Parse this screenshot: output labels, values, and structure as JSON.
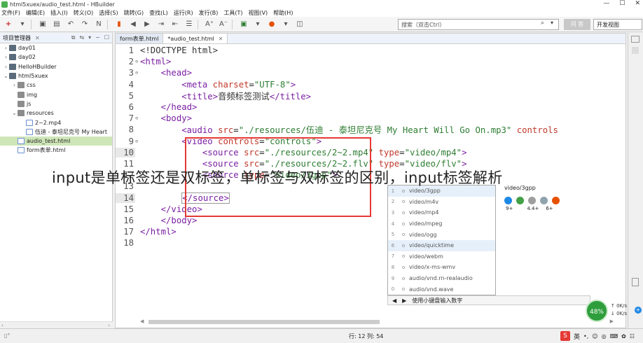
{
  "window": {
    "title": "html5xuex/audio_test.html  -  HBuilder"
  },
  "menu": [
    "文件(F)",
    "编辑(E)",
    "插入(I)",
    "转义(O)",
    "选择(S)",
    "跳转(G)",
    "查找(L)",
    "运行(R)",
    "发行(B)",
    "工具(T)",
    "视图(V)",
    "帮助(H)"
  ],
  "toolbar": {
    "search_placeholder": "搜索（双击Ctrl）",
    "ask_label": "问 答",
    "view_select": "开发视图"
  },
  "project_panel": {
    "title": "项目管理器",
    "items": [
      {
        "label": "day01",
        "depth": 0,
        "arrow": ">",
        "icon": "project"
      },
      {
        "label": "day02",
        "depth": 0,
        "arrow": ">",
        "icon": "project"
      },
      {
        "label": "HelloHBuilder",
        "depth": 0,
        "arrow": ">",
        "icon": "project"
      },
      {
        "label": "html5xuex",
        "depth": 0,
        "arrow": "v",
        "icon": "project"
      },
      {
        "label": "css",
        "depth": 1,
        "arrow": ">",
        "icon": "folder"
      },
      {
        "label": "img",
        "depth": 1,
        "arrow": "",
        "icon": "folder"
      },
      {
        "label": "js",
        "depth": 1,
        "arrow": "",
        "icon": "folder"
      },
      {
        "label": "resources",
        "depth": 1,
        "arrow": "v",
        "icon": "folder"
      },
      {
        "label": "2~2.mp4",
        "depth": 2,
        "arrow": "",
        "icon": "file"
      },
      {
        "label": "伍迪 - 泰坦尼克号 My Heart",
        "depth": 2,
        "arrow": "",
        "icon": "file"
      },
      {
        "label": "audio_test.html",
        "depth": 1,
        "arrow": "",
        "icon": "file",
        "selected": true
      },
      {
        "label": "form表单.html",
        "depth": 1,
        "arrow": "",
        "icon": "file"
      }
    ]
  },
  "tabs": [
    {
      "label": "form表单.html",
      "active": false
    },
    {
      "label": "*audio_test.html",
      "active": true
    }
  ],
  "code_lines": [
    {
      "n": "1",
      "fold": "",
      "html": "<span class='t-txt'>&lt;!DOCTYPE html&gt;</span>"
    },
    {
      "n": "2",
      "fold": "⊖",
      "html": "<span class='t-tag'>&lt;html&gt;</span>"
    },
    {
      "n": "3",
      "fold": "⊖",
      "html": "    <span class='t-tag'>&lt;head&gt;</span>"
    },
    {
      "n": "4",
      "fold": "",
      "html": "        <span class='t-tag'>&lt;meta</span> <span class='t-attr'>charset</span>=<span class='t-val'>\"UTF-8\"</span><span class='t-tag'>&gt;</span>"
    },
    {
      "n": "5",
      "fold": "",
      "html": "        <span class='t-tag'>&lt;title&gt;</span><span class='t-txt'>音频标签测试</span><span class='t-tag'>&lt;/title&gt;</span>"
    },
    {
      "n": "6",
      "fold": "",
      "html": "    <span class='t-tag'>&lt;/head&gt;</span>"
    },
    {
      "n": "7",
      "fold": "⊖",
      "html": "    <span class='t-tag'>&lt;body&gt;</span>"
    },
    {
      "n": "8",
      "fold": "",
      "html": "        <span class='t-tag'>&lt;audio</span> <span class='t-attr'>src</span>=<span class='t-val'>\"./resources/伍迪 - 泰坦尼克号 My Heart Will Go On.mp3\"</span> <span class='t-attr'>controls</span>"
    },
    {
      "n": "9",
      "fold": "⊖",
      "html": "        <span class='t-tag'>&lt;video</span> <span class='t-attr'>controls</span>=<span class='t-val'>\"controls\"</span><span class='t-tag'>&gt;</span>"
    },
    {
      "n": "10",
      "fold": "",
      "html": "            <span class='t-tag'>&lt;source</span> <span class='t-attr'>src</span>=<span class='t-val'>\"./resources/2~2.mp4\"</span> <span class='t-attr'>type</span>=<span class='t-val'>\"video/mp4\"</span><span class='t-tag'>&gt;</span>",
      "hl": true
    },
    {
      "n": "11",
      "fold": "",
      "html": "            <span class='t-tag'>&lt;source</span> <span class='t-attr'>src</span>=<span class='t-val'>\"./resources/2~2.flv\"</span> <span class='t-attr'>type</span>=<span class='t-val'>\"video/flv\"</span><span class='t-tag'>&gt;</span>"
    },
    {
      "n": "12",
      "fold": "",
      "html": "            <span class='t-tag'>&lt;source</span> <span class='t-attr'>type</span>=<span class='t-val'>\"video/3gpp\"</span><span class='t-tag'>&gt;</span>"
    },
    {
      "n": "13",
      "fold": "",
      "html": ""
    },
    {
      "n": "14",
      "fold": "",
      "html": "        <span class='t-tag' style='border:1px solid #999'>&lt;/source&gt;</span>",
      "hl": true
    },
    {
      "n": "15",
      "fold": "",
      "html": "    <span class='t-tag'>&lt;/video&gt;</span>"
    },
    {
      "n": "16",
      "fold": "",
      "html": "    <span class='t-tag'>&lt;/body&gt;</span>"
    },
    {
      "n": "17",
      "fold": "",
      "html": "<span class='t-tag'>&lt;/html&gt;</span>"
    },
    {
      "n": "18",
      "fold": "",
      "html": ""
    }
  ],
  "autocomplete": {
    "items": [
      {
        "n": "1",
        "label": "video/3gpp",
        "sel": true
      },
      {
        "n": "2",
        "label": "video/m4v"
      },
      {
        "n": "3",
        "label": "video/mp4"
      },
      {
        "n": "4",
        "label": "video/mpeg"
      },
      {
        "n": "5",
        "label": "video/ogg"
      },
      {
        "n": "6",
        "label": "video/quicktime",
        "sel": true
      },
      {
        "n": "7",
        "label": "video/webm"
      },
      {
        "n": "8",
        "label": "video/x-ms-wmv"
      },
      {
        "n": "9",
        "label": "audio/vnd.rn-realaudio"
      },
      {
        "n": "0",
        "label": "audio/vnd.wave"
      }
    ],
    "detail_title": "video/3gpp",
    "browser_versions": [
      "9+",
      "4.4+",
      "6+"
    ],
    "ime_hint": "使用小键盘输入数字"
  },
  "overlay_caption": "input是单标签还是双标签，单标签与双标签的区别，input标签解析",
  "status": {
    "position": "行: 12 列: 54",
    "left_icon": "▯°"
  },
  "network": {
    "percent": "48%",
    "up": "0K/s",
    "down": "0K/s"
  },
  "tray": {
    "ime": "S",
    "lang": "英"
  }
}
